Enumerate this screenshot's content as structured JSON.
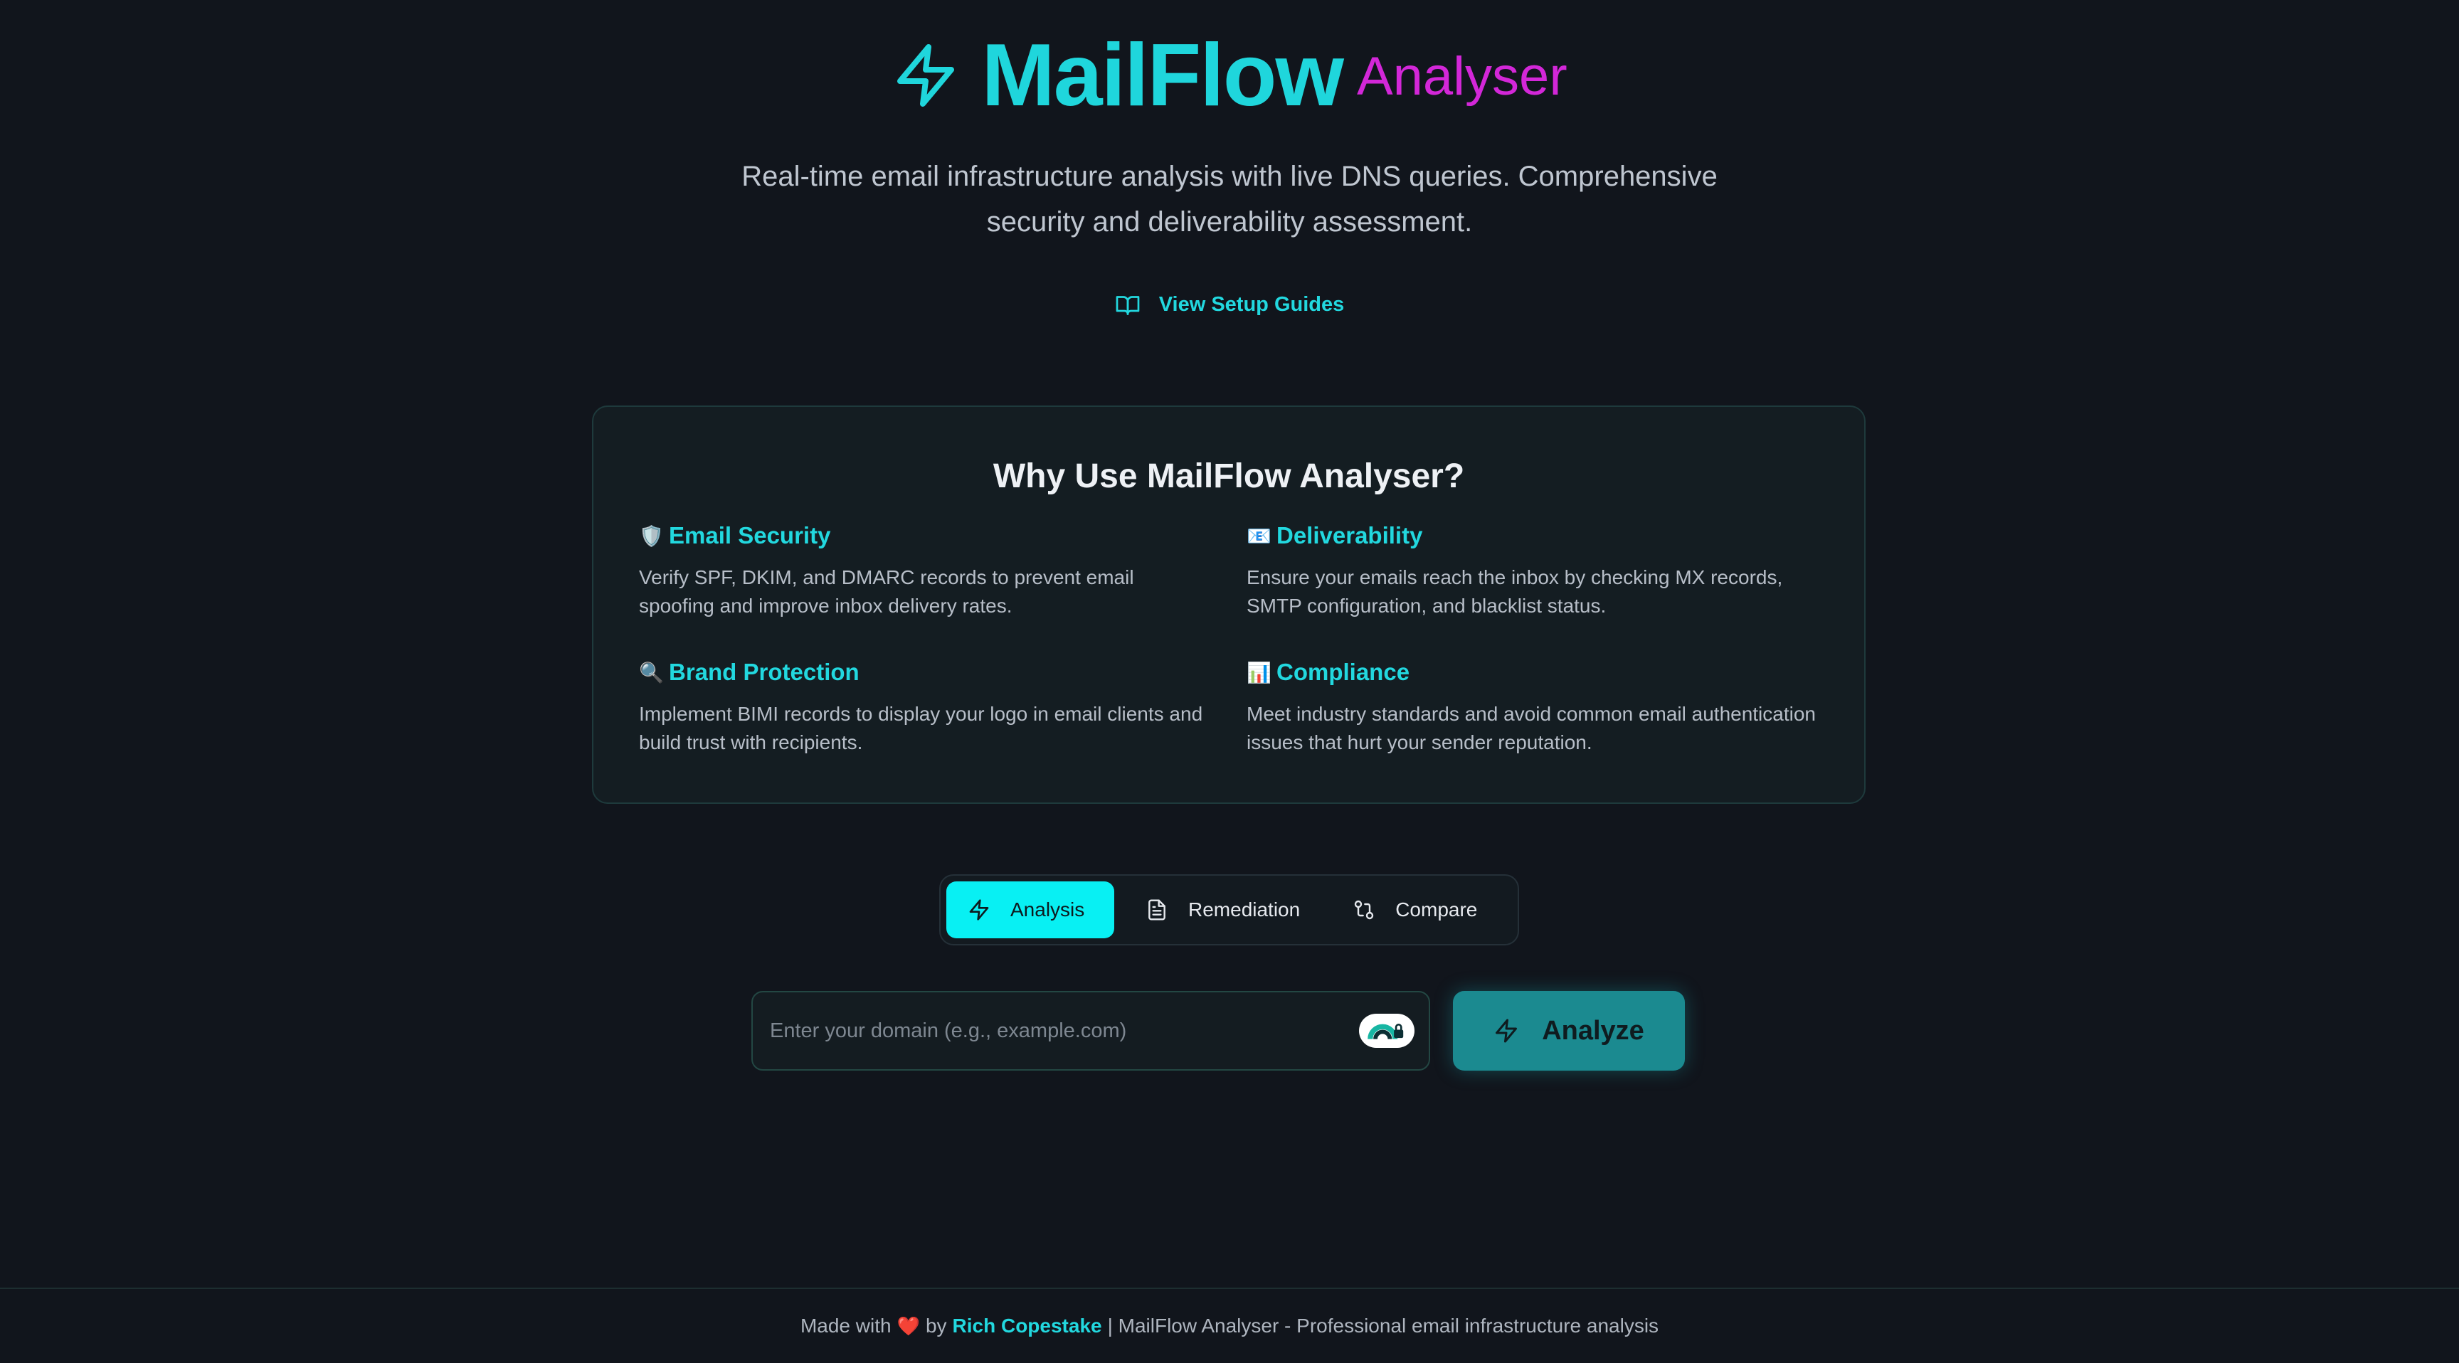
{
  "header": {
    "title": "MailFlow",
    "subtitle": "Analyser",
    "tagline": "Real-time email infrastructure analysis with live DNS queries. Comprehensive security and deliverability assessment.",
    "guides_link": "View Setup Guides"
  },
  "why": {
    "title": "Why Use MailFlow Analyser?",
    "features": [
      {
        "emoji": "🛡️",
        "title": "Email Security",
        "desc": "Verify SPF, DKIM, and DMARC records to prevent email spoofing and improve inbox delivery rates."
      },
      {
        "emoji": "📧",
        "title": "Deliverability",
        "desc": "Ensure your emails reach the inbox by checking MX records, SMTP configuration, and blacklist status."
      },
      {
        "emoji": "🔍",
        "title": "Brand Protection",
        "desc": "Implement BIMI records to display your logo in email clients and build trust with recipients."
      },
      {
        "emoji": "📊",
        "title": "Compliance",
        "desc": "Meet industry standards and avoid common email authentication issues that hurt your sender reputation."
      }
    ]
  },
  "tabs": [
    {
      "label": "Analysis",
      "active": true
    },
    {
      "label": "Remediation",
      "active": false
    },
    {
      "label": "Compare",
      "active": false
    }
  ],
  "search": {
    "placeholder": "Enter your domain (e.g., example.com)",
    "value": "",
    "button_label": "Analyze"
  },
  "footer": {
    "made_with": "Made with",
    "heart": "❤️",
    "by": "by",
    "author": "Rich Copestake",
    "suffix": "| MailFlow Analyser - Professional email infrastructure analysis"
  },
  "colors": {
    "background": "#11151c",
    "accent_cyan": "#22d8df",
    "accent_magenta": "#d327d8",
    "active_tab": "#08f0f3",
    "analyze_button": "#1b8a90"
  },
  "icons": {
    "brand": "lightning-bolt-icon",
    "guides": "book-open-icon",
    "analysis_tab": "lightning-bolt-icon",
    "remediation_tab": "file-text-icon",
    "compare_tab": "git-compare-icon",
    "password_badge": "password-manager-icon",
    "analyze_button": "lightning-bolt-icon"
  }
}
